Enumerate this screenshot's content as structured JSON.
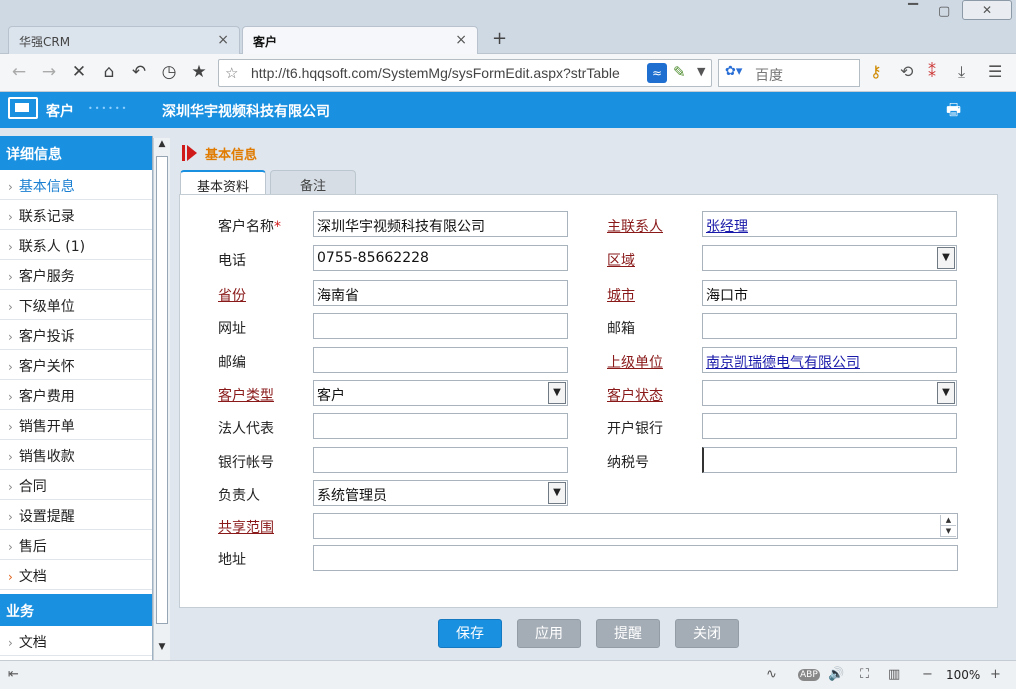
{
  "browser": {
    "tabs": [
      {
        "label": "华强CRM",
        "close": "×"
      },
      {
        "label": "客户",
        "close": "×"
      }
    ],
    "new_tab": "+",
    "window_controls": {
      "minimize": "▔",
      "maximize": "▢",
      "close": "✕"
    },
    "nav": {
      "back": "←",
      "forward": "→",
      "stop": "✕",
      "home": "⌂",
      "undo": "↶",
      "history": "◷",
      "favorites": "★"
    },
    "url": "http://t6.hqqsoft.com/SystemMg/sysFormEdit.aspx?strTable",
    "url_star": "☆",
    "search_placeholder": "百度",
    "search_engine_icon": "🐾",
    "zoom": "100%"
  },
  "header": {
    "module": "客户",
    "company": "深圳华宇视频科技有限公司",
    "printer_icon": "🖶"
  },
  "sidebar": {
    "section1": "详细信息",
    "items": [
      {
        "label": "基本信息"
      },
      {
        "label": "联系记录"
      },
      {
        "label": "联系人 (1)"
      },
      {
        "label": "客户服务"
      },
      {
        "label": "下级单位"
      },
      {
        "label": "客户投诉"
      },
      {
        "label": "客户关怀"
      },
      {
        "label": "客户费用"
      },
      {
        "label": "销售开单"
      },
      {
        "label": "销售收款"
      },
      {
        "label": "合同"
      },
      {
        "label": "设置提醒"
      },
      {
        "label": "售后"
      },
      {
        "label": "文档"
      }
    ],
    "section2": "业务",
    "next_item": "文档"
  },
  "form": {
    "section_title": "基本信息",
    "tabs": [
      "基本资料",
      "备注"
    ],
    "fields": {
      "customer_name": {
        "label": "客户名称",
        "required": "*",
        "value": "深圳华宇视频科技有限公司"
      },
      "main_contact": {
        "label": "主联系人",
        "value": "张经理"
      },
      "phone": {
        "label": "电话",
        "value": "0755-85662228"
      },
      "region": {
        "label": "区域",
        "value": ""
      },
      "province": {
        "label": "省份",
        "value": "海南省"
      },
      "city": {
        "label": "城市",
        "value": "海口市"
      },
      "website": {
        "label": "网址",
        "value": ""
      },
      "email": {
        "label": "邮箱",
        "value": ""
      },
      "zipcode": {
        "label": "邮编",
        "value": ""
      },
      "parent_org": {
        "label": "上级单位",
        "value": "南京凯瑞德电气有限公司"
      },
      "customer_type": {
        "label": "客户类型",
        "value": "客户"
      },
      "customer_status": {
        "label": "客户状态",
        "value": ""
      },
      "legal_rep": {
        "label": "法人代表",
        "value": ""
      },
      "bank": {
        "label": "开户银行",
        "value": ""
      },
      "bank_account": {
        "label": "银行帐号",
        "value": ""
      },
      "tax_id": {
        "label": "纳税号",
        "value": ""
      },
      "owner": {
        "label": "负责人",
        "value": "系统管理员"
      },
      "share_scope": {
        "label": "共享范围",
        "value": ""
      },
      "address": {
        "label": "地址",
        "value": ""
      }
    }
  },
  "buttons": {
    "save": "保存",
    "apply": "应用",
    "remind": "提醒",
    "close": "关闭"
  },
  "colors": {
    "accent": "#1a90e0",
    "link_label": "#8a1a1a",
    "required": "#d01a1a",
    "section_title": "#e07b00"
  }
}
